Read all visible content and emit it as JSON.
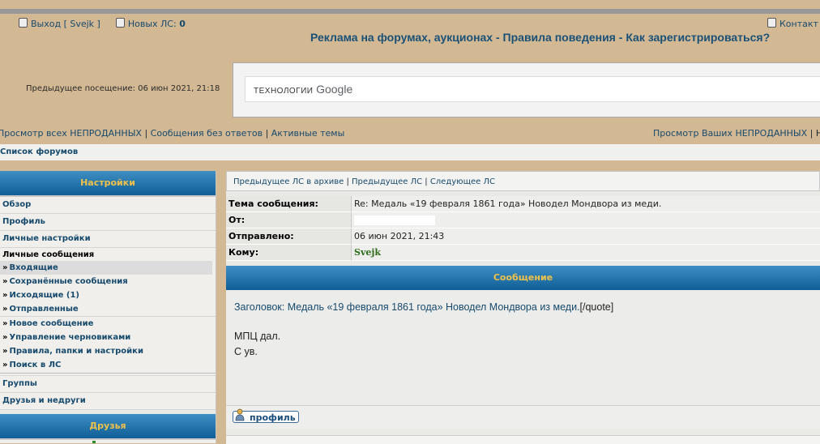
{
  "top": {
    "logout_label": "Выход [ Svejk ]",
    "new_pm_label": "Новых ЛС:",
    "new_pm_count": "0",
    "contact_label": "Контакт"
  },
  "nav": {
    "ads_link": "Реклама на форумах, аукционах",
    "sep1": " - ",
    "rules_link": "Правила поведения",
    "sep2": " - ",
    "register_link": "Как зарегистрироваться?"
  },
  "last_visit": "Предыдущее посещение: 06 июн 2021, 21:18",
  "search": {
    "label": "ТЕХНОЛОГИИ",
    "brand": "Google"
  },
  "links": {
    "view_unsold": "Просмотр всех НЕПРОДАННЫХ",
    "sep": " | ",
    "unanswered": "Сообщения без ответов",
    "active": "Активные темы",
    "your_unsold": "Просмотр Ваших НЕПРОДАННЫХ",
    "cut_sep": " | Н"
  },
  "breadcrumb": "Список форумов",
  "sidebar": {
    "settings_header": "Настройки",
    "overview": "Обзор",
    "profile": "Профиль",
    "personal_settings": "Личные настройки",
    "pm_group": "Личные сообщения",
    "pm_items": [
      "Входящие",
      "Сохранённые сообщения",
      "Исходящие (1)",
      "Отправленные",
      "Новое сообщение",
      "Управление черновиками",
      "Правила, папки и настройки",
      "Поиск в ЛС"
    ],
    "groups": "Группы",
    "friends_foes": "Друзья и недруги",
    "friends_header": "Друзья"
  },
  "pm_nav": {
    "prev_archive": "Предыдущее ЛС в архиве",
    "prev": "Предыдущее ЛС",
    "next": "Следующее ЛС",
    "sep": " | "
  },
  "headers": [
    {
      "label": "Тема сообщения:",
      "value": "Re: Медаль «19 февраля 1861 года» Новодел Мондвора из меди."
    },
    {
      "label": "От:",
      "value": ""
    },
    {
      "label": "Отправлено:",
      "value": "06 июн 2021, 21:43"
    },
    {
      "label": "Кому:",
      "value": "Svejk"
    }
  ],
  "message": {
    "header": "Сообщение",
    "title_link": "Заголовок: Медаль «19 февраля 1861 года» Новодел Мондвора из меди.",
    "title_tail": "[/quote]",
    "line1": "МПЦ дал.",
    "line2": "С ув."
  },
  "profile_button": "профиль",
  "colors": {
    "tan_bg": "#d3b894",
    "link_blue": "#174a6d",
    "header_gold": "#f1c24a",
    "header_blue": "#0f5f96",
    "green_user": "#2e6b1b"
  }
}
